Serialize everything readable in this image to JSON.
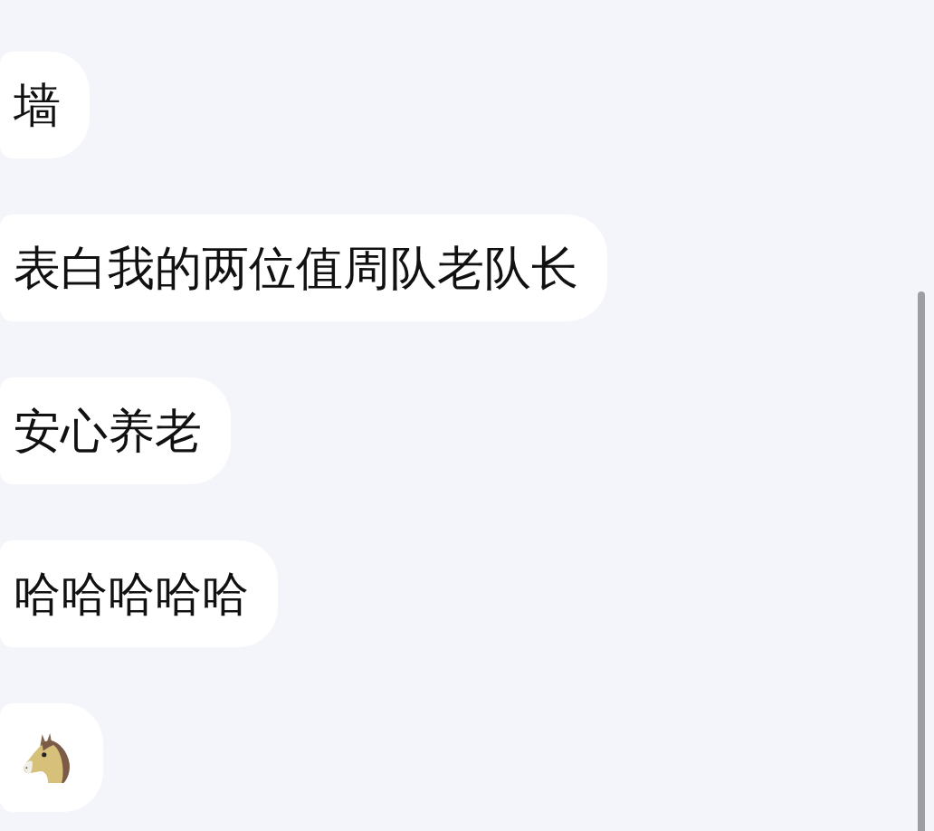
{
  "messages": [
    {
      "kind": "text",
      "text": "墙"
    },
    {
      "kind": "text",
      "text": "表白我的两位值周队老队长"
    },
    {
      "kind": "text",
      "text": "安心养老"
    },
    {
      "kind": "text",
      "text": "哈哈哈哈哈"
    },
    {
      "kind": "emoji"
    }
  ]
}
